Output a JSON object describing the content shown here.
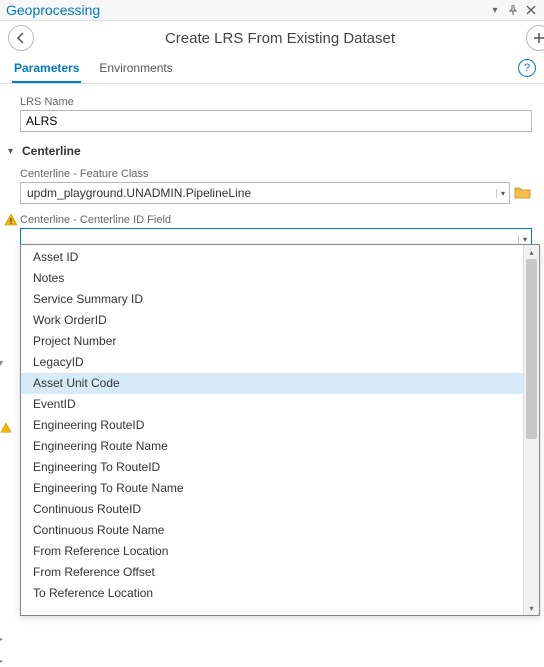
{
  "panel_title": "Geoprocessing",
  "tool_title": "Create LRS From Existing Dataset",
  "tabs": {
    "parameters": "Parameters",
    "environments": "Environments"
  },
  "help_symbol": "?",
  "lrs_name": {
    "label": "LRS Name",
    "value": "ALRS"
  },
  "section_centerline": {
    "title": "Centerline",
    "feature_class": {
      "label": "Centerline - Feature Class",
      "value": "updm_playground.UNADMIN.PipelineLine"
    },
    "id_field": {
      "label": "Centerline - Centerline ID Field",
      "value": ""
    }
  },
  "dropdown": {
    "highlighted_index": 6,
    "items": [
      "Asset ID",
      "Notes",
      "Service Summary ID",
      "Work OrderID",
      "Project Number",
      "LegacyID",
      "Asset Unit Code",
      "EventID",
      "Engineering RouteID",
      "Engineering Route Name",
      "Engineering To RouteID",
      "Engineering To Route Name",
      "Continuous RouteID",
      "Continuous Route Name",
      "From Reference Location",
      "From Reference Offset",
      "To Reference Location"
    ]
  }
}
